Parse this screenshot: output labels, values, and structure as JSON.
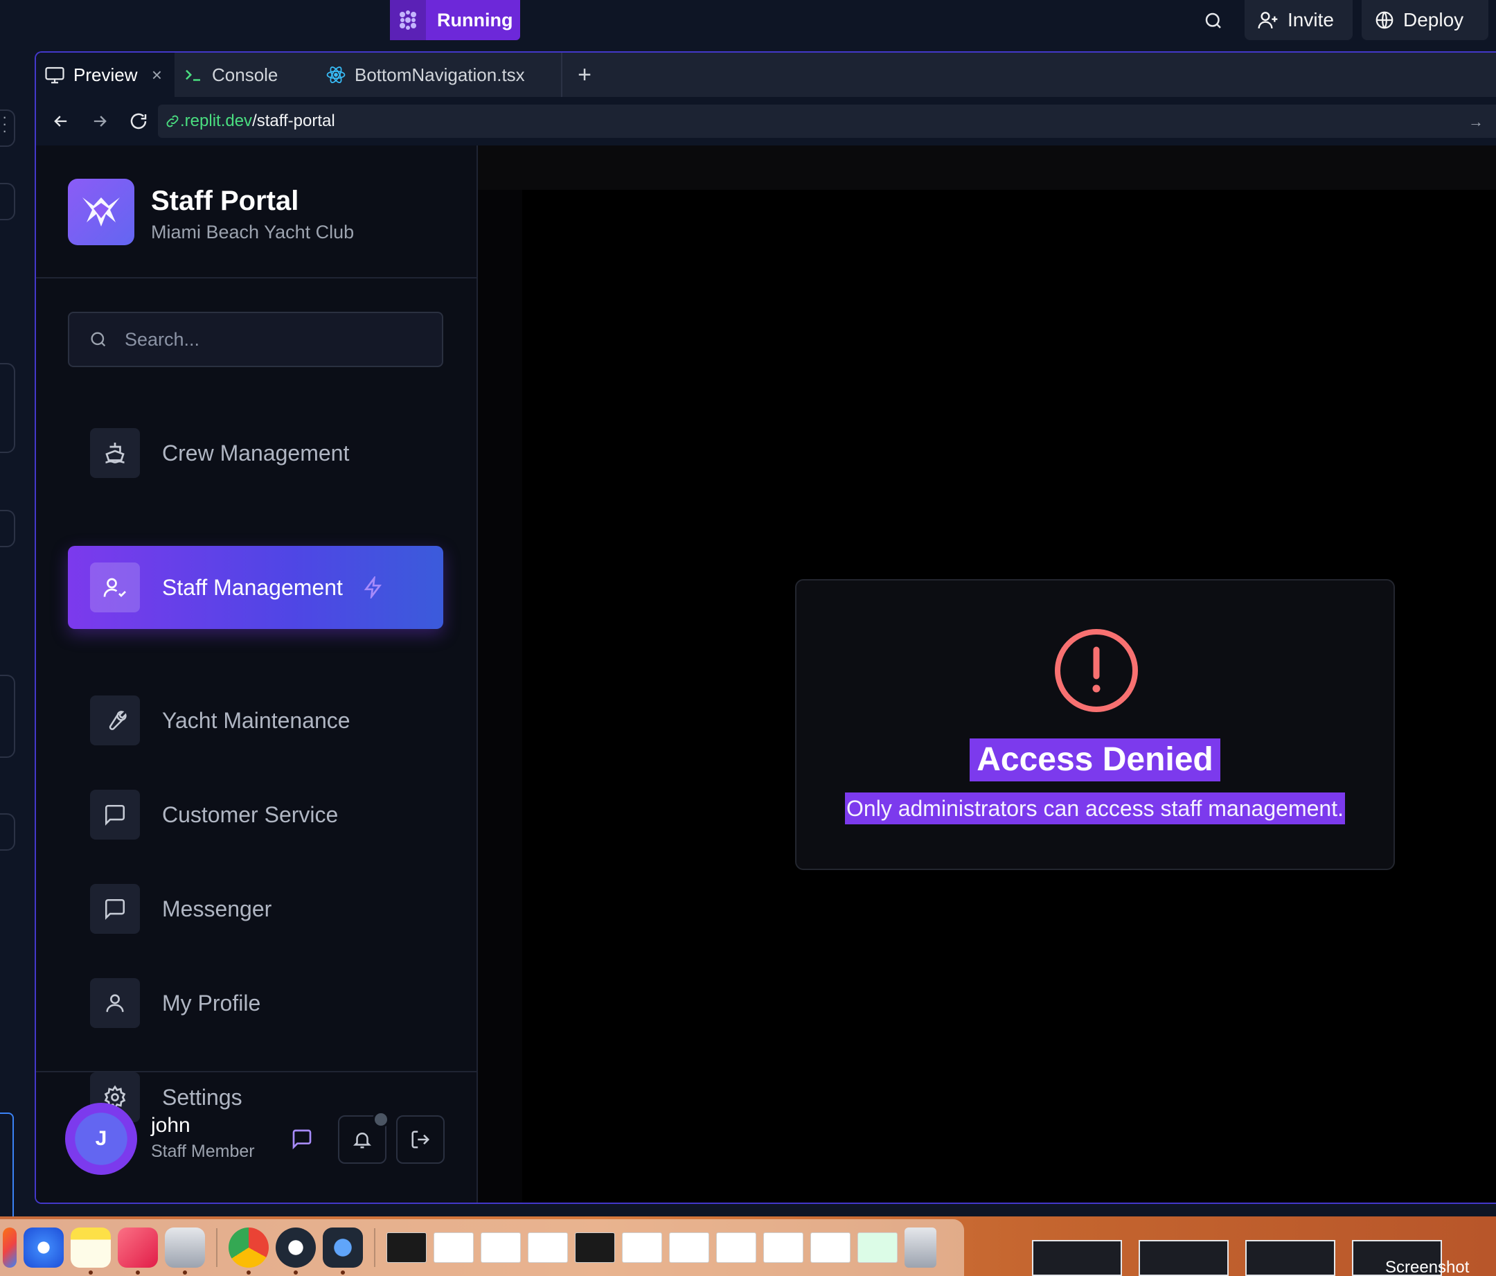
{
  "topbar": {
    "run_label": "Running",
    "invite_label": "Invite",
    "deploy_label": "Deploy"
  },
  "tabs": [
    {
      "label": "Preview",
      "icon": "monitor-icon"
    },
    {
      "label": "Console",
      "icon": "terminal-icon"
    },
    {
      "label": "BottomNavigation.tsx",
      "icon": "react-icon"
    }
  ],
  "url": {
    "domain": ".replit.dev",
    "path": "/staff-portal"
  },
  "app": {
    "title": "Staff Portal",
    "subtitle": "Miami Beach Yacht Club",
    "search_placeholder": "Search...",
    "nav": [
      {
        "label": "Crew Management",
        "icon": "ship-icon",
        "active": false
      },
      {
        "label": "Staff Management",
        "icon": "user-check-icon",
        "active": true
      },
      {
        "label": "Yacht Maintenance",
        "icon": "wrench-icon",
        "active": false
      },
      {
        "label": "Customer Service",
        "icon": "message-square-icon",
        "active": false
      },
      {
        "label": "Messenger",
        "icon": "message-square-icon",
        "active": false
      },
      {
        "label": "My Profile",
        "icon": "user-icon",
        "active": false
      },
      {
        "label": "Settings",
        "icon": "gear-icon",
        "active": false
      }
    ],
    "user": {
      "initial": "J",
      "name": "john",
      "role": "Staff Member"
    },
    "access": {
      "title": "Access Denied",
      "message": "Only administrators can access staff management."
    }
  },
  "desktop": {
    "screenshot_label": "Screenshot"
  },
  "colors": {
    "accent": "#7c3aed",
    "alert": "#f87171",
    "url_domain": "#4ade80"
  }
}
